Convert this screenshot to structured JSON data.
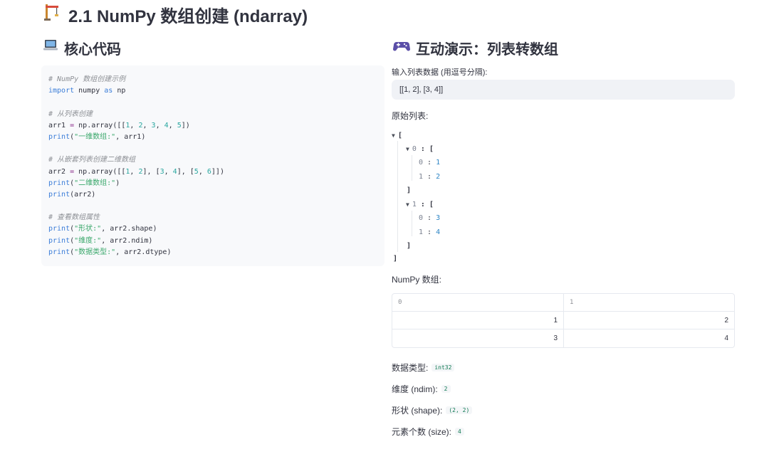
{
  "page": {
    "title": "2.1 NumPy 数组创建 (ndarray)",
    "title_icon": "construction-crane-icon"
  },
  "left": {
    "heading": "核心代码",
    "heading_icon": "laptop-icon",
    "code_lines": [
      [
        {
          "t": "c",
          "v": "# NumPy 数组创建示例"
        }
      ],
      [
        {
          "t": "k",
          "v": "import"
        },
        {
          "t": "p",
          "v": " numpy "
        },
        {
          "t": "k",
          "v": "as"
        },
        {
          "t": "p",
          "v": " np"
        }
      ],
      [],
      [
        {
          "t": "c",
          "v": "# 从列表创建"
        }
      ],
      [
        {
          "t": "p",
          "v": "arr1 "
        },
        {
          "t": "o",
          "v": "="
        },
        {
          "t": "p",
          "v": " np.array([["
        },
        {
          "t": "n",
          "v": "1"
        },
        {
          "t": "p",
          "v": ", "
        },
        {
          "t": "n",
          "v": "2"
        },
        {
          "t": "p",
          "v": ", "
        },
        {
          "t": "n",
          "v": "3"
        },
        {
          "t": "p",
          "v": ", "
        },
        {
          "t": "n",
          "v": "4"
        },
        {
          "t": "p",
          "v": ", "
        },
        {
          "t": "n",
          "v": "5"
        },
        {
          "t": "p",
          "v": "])"
        }
      ],
      [
        {
          "t": "k",
          "v": "print"
        },
        {
          "t": "p",
          "v": "("
        },
        {
          "t": "s",
          "v": "\"一维数组:\""
        },
        {
          "t": "p",
          "v": ", arr1)"
        }
      ],
      [],
      [
        {
          "t": "c",
          "v": "# 从嵌套列表创建二维数组"
        }
      ],
      [
        {
          "t": "p",
          "v": "arr2 "
        },
        {
          "t": "o",
          "v": "="
        },
        {
          "t": "p",
          "v": " np.array([["
        },
        {
          "t": "n",
          "v": "1"
        },
        {
          "t": "p",
          "v": ", "
        },
        {
          "t": "n",
          "v": "2"
        },
        {
          "t": "p",
          "v": "], ["
        },
        {
          "t": "n",
          "v": "3"
        },
        {
          "t": "p",
          "v": ", "
        },
        {
          "t": "n",
          "v": "4"
        },
        {
          "t": "p",
          "v": "], ["
        },
        {
          "t": "n",
          "v": "5"
        },
        {
          "t": "p",
          "v": ", "
        },
        {
          "t": "n",
          "v": "6"
        },
        {
          "t": "p",
          "v": "]])"
        }
      ],
      [
        {
          "t": "k",
          "v": "print"
        },
        {
          "t": "p",
          "v": "("
        },
        {
          "t": "s",
          "v": "\"二维数组:\""
        },
        {
          "t": "p",
          "v": ")"
        }
      ],
      [
        {
          "t": "k",
          "v": "print"
        },
        {
          "t": "p",
          "v": "(arr2)"
        }
      ],
      [],
      [
        {
          "t": "c",
          "v": "# 查看数组属性"
        }
      ],
      [
        {
          "t": "k",
          "v": "print"
        },
        {
          "t": "p",
          "v": "("
        },
        {
          "t": "s",
          "v": "\"形状:\""
        },
        {
          "t": "p",
          "v": ", arr2.shape)"
        }
      ],
      [
        {
          "t": "k",
          "v": "print"
        },
        {
          "t": "p",
          "v": "("
        },
        {
          "t": "s",
          "v": "\"维度:\""
        },
        {
          "t": "p",
          "v": ", arr2.ndim)"
        }
      ],
      [
        {
          "t": "k",
          "v": "print"
        },
        {
          "t": "p",
          "v": "("
        },
        {
          "t": "s",
          "v": "\"数据类型:\""
        },
        {
          "t": "p",
          "v": ", arr2.dtype)"
        }
      ]
    ]
  },
  "right": {
    "heading": "互动演示：列表转数组",
    "heading_icon": "gamepad-icon",
    "input_label": "输入列表数据 (用逗号分隔):",
    "input_value": "[[1, 2], [3, 4]]",
    "original_label": "原始列表:",
    "json_tree": {
      "open_bracket": "[",
      "close_bracket": "]",
      "groups": [
        {
          "key": "0",
          "open": "[",
          "close": "]",
          "items": [
            {
              "key": "0",
              "value": "1"
            },
            {
              "key": "1",
              "value": "2"
            }
          ]
        },
        {
          "key": "1",
          "open": "[",
          "close": "]",
          "items": [
            {
              "key": "0",
              "value": "3"
            },
            {
              "key": "1",
              "value": "4"
            }
          ]
        }
      ]
    },
    "array_label": "NumPy 数组:",
    "table": {
      "headers": [
        "0",
        "1"
      ],
      "rows": [
        [
          "1",
          "2"
        ],
        [
          "3",
          "4"
        ]
      ]
    },
    "props": [
      {
        "label": "数据类型:",
        "value": "int32"
      },
      {
        "label": "维度 (ndim):",
        "value": "2"
      },
      {
        "label": "形状 (shape):",
        "value": "(2, 2)"
      },
      {
        "label": "元素个数 (size):",
        "value": "4"
      }
    ]
  },
  "colors": {
    "code_keyword": "#3b7dd8",
    "code_string": "#3aa86b",
    "code_number": "#2aa7a0",
    "json_value": "#2f86c6",
    "badge_text": "#0f7a52"
  }
}
